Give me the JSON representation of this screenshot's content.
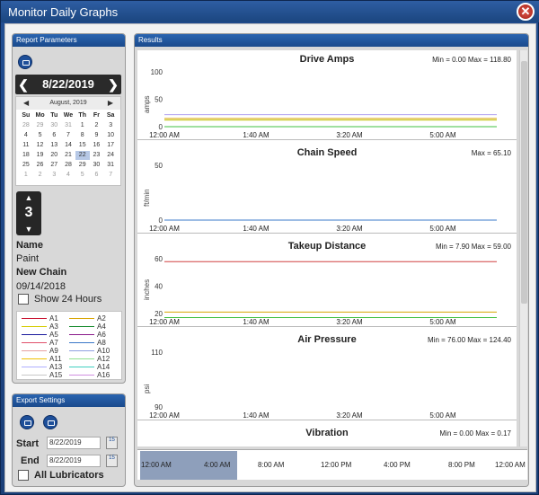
{
  "window": {
    "title": "Monitor Daily Graphs"
  },
  "report_params": {
    "header": "Report Parameters",
    "date": "8/22/2019",
    "calendar": {
      "month_label": "August, 2019",
      "weekdays": [
        "Su",
        "Mo",
        "Tu",
        "We",
        "Th",
        "Fr",
        "Sa"
      ],
      "days": [
        [
          "28",
          "29",
          "30",
          "31",
          "1",
          "2",
          "3"
        ],
        [
          "4",
          "5",
          "6",
          "7",
          "8",
          "9",
          "10"
        ],
        [
          "11",
          "12",
          "13",
          "14",
          "15",
          "16",
          "17"
        ],
        [
          "18",
          "19",
          "20",
          "21",
          "22",
          "23",
          "24"
        ],
        [
          "25",
          "26",
          "27",
          "28",
          "29",
          "30",
          "31"
        ],
        [
          "1",
          "2",
          "3",
          "4",
          "5",
          "6",
          "7"
        ]
      ],
      "selected_day": "22"
    },
    "stepper_value": "3",
    "name_label": "Name",
    "name_value": "Paint",
    "chain_label": "New Chain",
    "chain_date": "09/14/2018",
    "show24_label": "Show 24 Hours",
    "legend": [
      {
        "label": "A1",
        "color": "#c8102e"
      },
      {
        "label": "A2",
        "color": "#d8a400"
      },
      {
        "label": "A3",
        "color": "#d4cc00"
      },
      {
        "label": "A4",
        "color": "#138a2b"
      },
      {
        "label": "A5",
        "color": "#1a1a9c"
      },
      {
        "label": "A6",
        "color": "#8a1a8a"
      },
      {
        "label": "A7",
        "color": "#e0506a"
      },
      {
        "label": "A8",
        "color": "#3a78c8"
      },
      {
        "label": "A9",
        "color": "#e6a0a0"
      },
      {
        "label": "A10",
        "color": "#8fa0e0"
      },
      {
        "label": "A11",
        "color": "#f0c000"
      },
      {
        "label": "A12",
        "color": "#90e090"
      },
      {
        "label": "A13",
        "color": "#b0b0ff"
      },
      {
        "label": "A14",
        "color": "#40d0c0"
      },
      {
        "label": "A15",
        "color": "#c8c8c8"
      },
      {
        "label": "A16",
        "color": "#d090e0"
      }
    ]
  },
  "export": {
    "header": "Export Settings",
    "start_label": "Start",
    "start_value": "8/22/2019",
    "end_label": "End",
    "end_value": "8/22/2019",
    "lubricators_label": "All Lubricators",
    "calbtn_text": "15"
  },
  "results": {
    "header": "Results",
    "time_ticks": [
      "12:00 AM",
      "4:00 AM",
      "8:00 AM",
      "12:00 PM",
      "4:00 PM",
      "8:00 PM",
      "12:00 AM"
    ],
    "charts": [
      {
        "title": "Drive Amps",
        "minmax": "Min = 0.00 Max = 118.80",
        "ylabel": "amps",
        "yticks": [
          "100",
          "50",
          "0"
        ],
        "xticks": [
          "12:00 AM",
          "1:40 AM",
          "3:20 AM",
          "5:00 AM"
        ],
        "lines": [
          {
            "y": 22,
            "color": "#b0a0f0"
          },
          {
            "y": 15,
            "color": "#d8a400"
          },
          {
            "y": 12,
            "color": "#c0c000"
          },
          {
            "y": 0,
            "color": "#40c040"
          }
        ],
        "ymax": 100
      },
      {
        "title": "Chain Speed",
        "minmax": "Max = 65.10",
        "ylabel": "ft/min",
        "yticks": [
          "50",
          "0"
        ],
        "xticks": [
          "12:00 AM",
          "1:40 AM",
          "3:20 AM",
          "5:00 AM"
        ],
        "lines": [
          {
            "y": 0,
            "color": "#3a78c8"
          }
        ],
        "ymax": 50
      },
      {
        "title": "Takeup Distance",
        "minmax": "Min = 7.90 Max = 59.00",
        "ylabel": "inches",
        "yticks": [
          "60",
          "40",
          "20"
        ],
        "xticks": [
          "12:00 AM",
          "1:40 AM",
          "3:20 AM",
          "5:00 AM"
        ],
        "lines": [
          {
            "y": 59,
            "color": "#d04040"
          },
          {
            "y": 13,
            "color": "#d8a400"
          },
          {
            "y": 8,
            "color": "#40c040"
          }
        ],
        "ymax": 60
      },
      {
        "title": "Air Pressure",
        "minmax": "Min = 76.00 Max = 124.40",
        "ylabel": "psi",
        "yticks": [
          "110",
          "90"
        ],
        "xticks": [
          "12:00 AM",
          "1:40 AM",
          "3:20 AM",
          "5:00 AM"
        ],
        "lines": [],
        "ymax": 110
      },
      {
        "title": "Vibration",
        "minmax": "Min = 0.00 Max = 0.17",
        "ylabel": "",
        "yticks": [],
        "xticks": [],
        "lines": [],
        "ymax": 1
      }
    ]
  }
}
